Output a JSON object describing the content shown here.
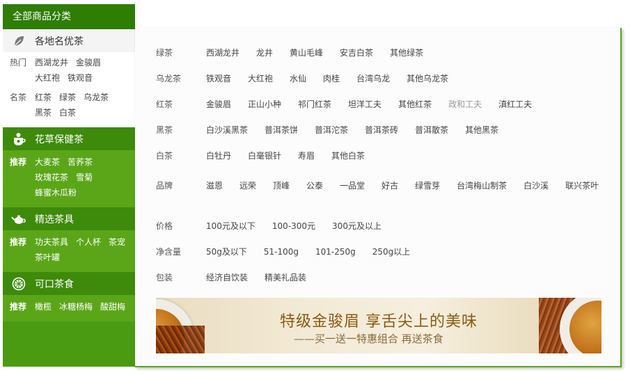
{
  "sidebar": {
    "title": "全部商品分类",
    "sections": [
      {
        "name": "各地名优茶",
        "icon": "leaf-icon",
        "rows": [
          {
            "label": "热门",
            "items": [
              "西湖龙井",
              "金骏眉",
              "大红袍",
              "铁观音"
            ]
          },
          {
            "label": "名茶",
            "items": [
              "红茶",
              "绿茶",
              "乌龙茶",
              "黑茶",
              "白茶"
            ]
          }
        ]
      },
      {
        "name": "花草保健茶",
        "icon": "flower-tea-icon",
        "rows": [
          {
            "label": "推荐",
            "items": [
              "大麦茶",
              "苦荞茶",
              "玫瑰花茶",
              "雪菊",
              "蜂蜜木瓜粉"
            ]
          }
        ]
      },
      {
        "name": "精选茶具",
        "icon": "teapot-icon",
        "rows": [
          {
            "label": "推荐",
            "items": [
              "功夫茶具",
              "个人杯",
              "茶宠",
              "茶叶罐"
            ]
          }
        ]
      },
      {
        "name": "可口茶食",
        "icon": "citrus-slice-icon",
        "rows": [
          {
            "label": "推荐",
            "items": [
              "橄榄",
              "冰糖杨梅",
              "酸甜梅"
            ]
          }
        ]
      }
    ]
  },
  "panel": {
    "rows": [
      {
        "label": "绿茶",
        "items": [
          "西湖龙井",
          "龙井",
          "黄山毛峰",
          "安吉白茶",
          "其他绿茶"
        ]
      },
      {
        "label": "乌龙茶",
        "items": [
          "铁观音",
          "大红袍",
          "水仙",
          "肉桂",
          "台湾乌龙",
          "其他乌龙茶"
        ]
      },
      {
        "label": "红茶",
        "items": [
          "金骏眉",
          "正山小种",
          "祁门红茶",
          "坦洋工夫",
          "其他红茶",
          "政和工夫",
          "滇红工夫"
        ]
      },
      {
        "label": "黑茶",
        "items": [
          "白沙溪黑茶",
          "普洱茶饼",
          "普洱沱茶",
          "普洱茶砖",
          "普洱散茶",
          "其他黑茶"
        ]
      },
      {
        "label": "白茶",
        "items": [
          "白牡丹",
          "白毫银针",
          "寿眉",
          "其他白茶"
        ]
      },
      {
        "label": "品牌",
        "items": [
          "滋恩",
          "远荣",
          "顶峰",
          "公泰",
          "一品堂",
          "好古",
          "绿雪芽",
          "台湾梅山制茶",
          "白沙溪",
          "联兴茶叶"
        ]
      },
      {
        "label": "价格",
        "items": [
          "100元及以下",
          "100-300元",
          "300元及以上"
        ]
      },
      {
        "label": "净含量",
        "items": [
          "50g及以下",
          "51-100g",
          "101-250g",
          "250g以上"
        ]
      },
      {
        "label": "包装",
        "items": [
          "经济自饮装",
          "精美礼品装"
        ]
      }
    ],
    "muted_item": "政和工夫",
    "banner": {
      "title": "特级金骏眉 享舌尖上的美味",
      "subtitle": "——买一送一特惠组合 再送茶食"
    }
  },
  "colors": {
    "sidebar_green": "#4a9a12",
    "title_green": "#2e7d05",
    "accent_border": "#5aa618",
    "banner_text": "#8a5a12"
  }
}
